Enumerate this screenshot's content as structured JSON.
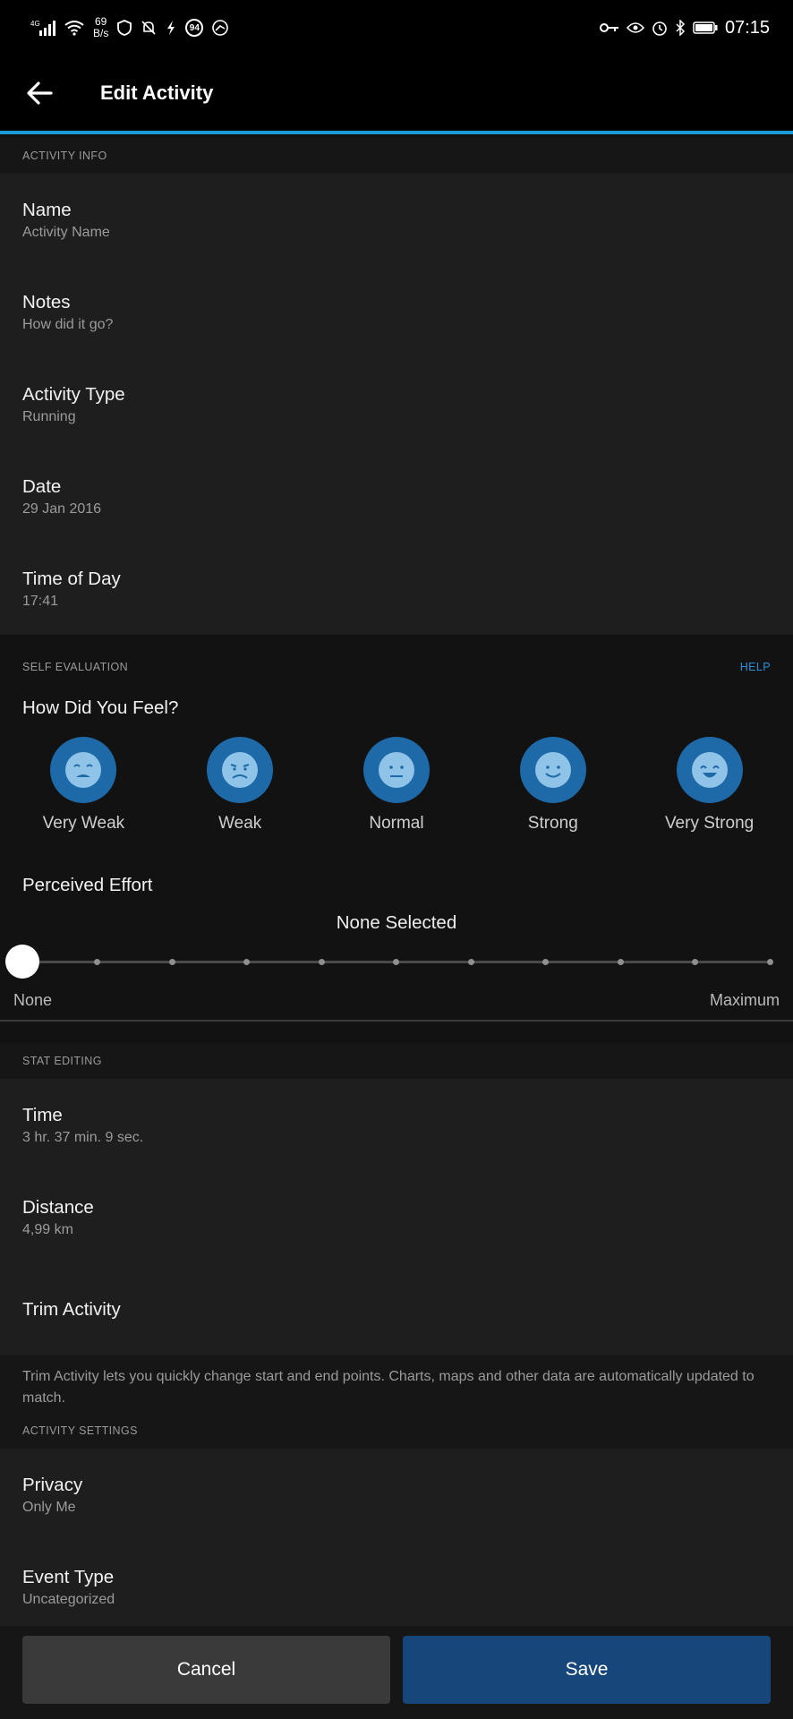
{
  "status_bar": {
    "network": "4G",
    "net_speed_value": "69",
    "net_speed_unit": "B/s",
    "notif_badge": "94",
    "time": "07:15"
  },
  "app_bar": {
    "title": "Edit Activity"
  },
  "activity_info": {
    "header": "ACTIVITY INFO",
    "rows": [
      {
        "title": "Name",
        "value": "Activity Name"
      },
      {
        "title": "Notes",
        "value": "How did it go?"
      },
      {
        "title": "Activity Type",
        "value": "Running"
      },
      {
        "title": "Date",
        "value": "29 Jan 2016"
      },
      {
        "title": "Time of Day",
        "value": "17:41"
      }
    ]
  },
  "self_evaluation": {
    "header": "SELF EVALUATION",
    "help": "HELP",
    "feel_title": "How Did You Feel?",
    "feel_options": [
      {
        "label": "Very Weak",
        "icon": "very-weak-face-icon"
      },
      {
        "label": "Weak",
        "icon": "weak-face-icon"
      },
      {
        "label": "Normal",
        "icon": "normal-face-icon"
      },
      {
        "label": "Strong",
        "icon": "strong-face-icon"
      },
      {
        "label": "Very Strong",
        "icon": "very-strong-face-icon"
      }
    ],
    "effort_title": "Perceived Effort",
    "effort_value": "None Selected",
    "effort_level": 0,
    "effort_min_label": "None",
    "effort_max_label": "Maximum"
  },
  "stat_editing": {
    "header": "STAT EDITING",
    "rows": [
      {
        "title": "Time",
        "value": "3 hr. 37 min. 9 sec."
      },
      {
        "title": "Distance",
        "value": "4,99 km"
      },
      {
        "title": "Trim Activity",
        "value": ""
      }
    ],
    "trim_help": "Trim Activity lets you quickly change start and end points. Charts, maps and other data are automatically updated to match."
  },
  "activity_settings": {
    "header": "ACTIVITY SETTINGS",
    "rows": [
      {
        "title": "Privacy",
        "value": "Only Me"
      },
      {
        "title": "Event Type",
        "value": "Uncategorized"
      }
    ]
  },
  "buttons": {
    "cancel": "Cancel",
    "save": "Save"
  },
  "colors": {
    "accent": "#1a9ad6",
    "feel_circle": "#1e6aa8",
    "save_button": "#17467a"
  }
}
